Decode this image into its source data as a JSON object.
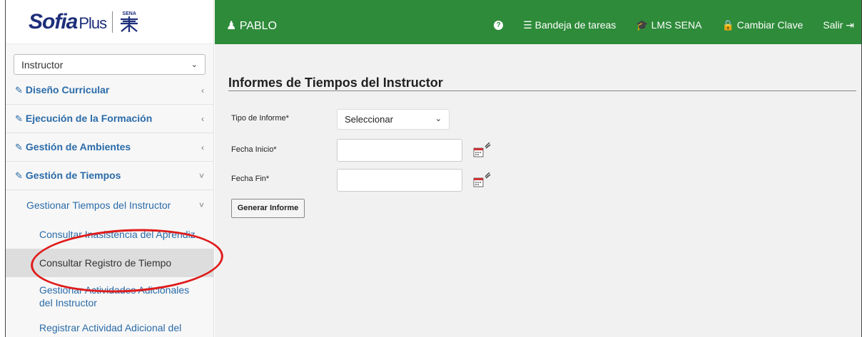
{
  "brand": {
    "name_italic": "Sofia",
    "name_plus": "Plus",
    "sena": "SENA"
  },
  "role_select": {
    "value": "Instructor"
  },
  "menu": [
    {
      "label": "Diseño Curricular",
      "chevron": "‹"
    },
    {
      "label": "Ejecución de la Formación",
      "chevron": "‹"
    },
    {
      "label": "Gestión de Ambientes",
      "chevron": "‹"
    },
    {
      "label": "Gestión de Tiempos",
      "chevron": "˅"
    }
  ],
  "submenu": {
    "label": "Gestionar Tiempos del Instructor",
    "chevron": "˅"
  },
  "subitems": [
    "Consultar Inasistencia del Aprendiz",
    "Consultar Registro de Tiempo",
    "Gestionar Actividades Adicionales del Instructor",
    "Registrar Actividad Adicional del Instructor"
  ],
  "topbar": {
    "user": "PABLO",
    "help": "?",
    "nav": [
      "Bandeja de tareas",
      "LMS SENA",
      "Cambiar Clave",
      "Salir"
    ]
  },
  "form": {
    "title": "Informes de Tiempos del Instructor",
    "tipo_label": "Tipo de Informe*",
    "tipo_value": "Seleccionar",
    "inicio_label": "Fecha Inicio*",
    "fin_label": "Fecha Fin*",
    "button": "Generar Informe"
  }
}
